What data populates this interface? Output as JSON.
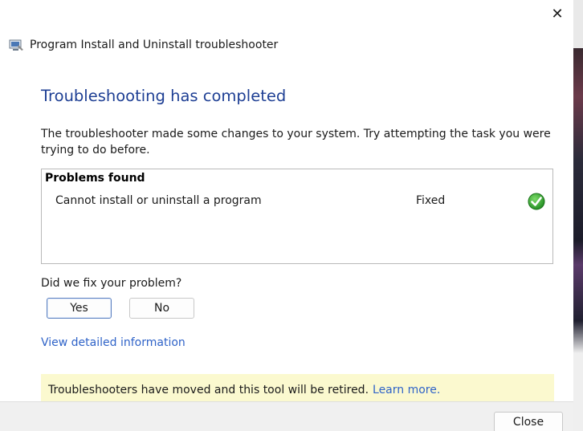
{
  "window": {
    "title": "Program Install and Uninstall troubleshooter",
    "close_glyph": "✕"
  },
  "content": {
    "heading": "Troubleshooting has completed",
    "description": "The troubleshooter made some changes to your system. Try attempting the task you were trying to do before.",
    "problems": {
      "header": "Problems found",
      "items": [
        {
          "name": "Cannot install or uninstall a program",
          "status": "Fixed",
          "status_icon": "green-check-icon"
        }
      ]
    },
    "question": "Did we fix your problem?",
    "yes_label": "Yes",
    "no_label": "No",
    "details_link": "View detailed information",
    "notice": {
      "text": "Troubleshooters have moved and this tool will be retired.",
      "link": "Learn more."
    }
  },
  "footer": {
    "close_label": "Close"
  },
  "colors": {
    "heading": "#1e3f94",
    "link": "#2f63c8",
    "notice_bg": "#fbf9cf",
    "check_green": "#2e9e2e"
  }
}
